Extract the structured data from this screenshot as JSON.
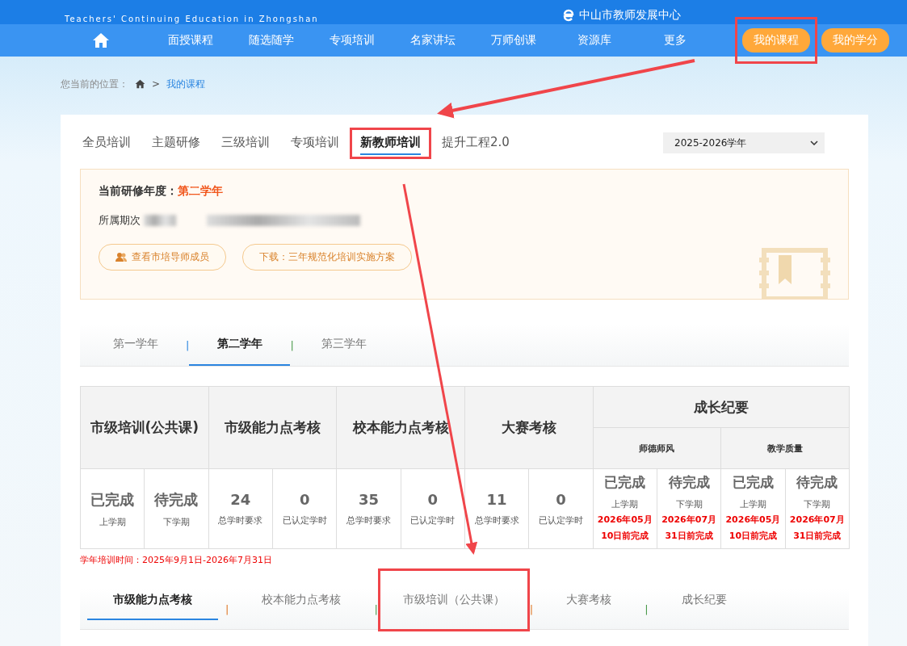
{
  "header": {
    "subtitle": "Teachers' Continuing Education in Zhongshan",
    "org": "中山市教师发展中心"
  },
  "nav": {
    "items": [
      {
        "label": "面授课程",
        "kind": "link",
        "highlighted": false
      },
      {
        "label": "随选随学",
        "kind": "link",
        "highlighted": false
      },
      {
        "label": "专项培训",
        "kind": "link",
        "highlighted": false
      },
      {
        "label": "名家讲坛",
        "kind": "link",
        "highlighted": false
      },
      {
        "label": "万师创课",
        "kind": "link",
        "highlighted": false
      },
      {
        "label": "资源库",
        "kind": "link",
        "highlighted": false
      },
      {
        "label": "更多",
        "kind": "link",
        "highlighted": false
      },
      {
        "label": "我的课程",
        "kind": "pill",
        "highlighted": true
      },
      {
        "label": "我的学分",
        "kind": "pill",
        "highlighted": false
      }
    ]
  },
  "breadcrumb": {
    "label": "您当前的位置：",
    "separator": ">",
    "current": "我的课程"
  },
  "category_tabs": [
    {
      "label": "全员培训",
      "selected": false,
      "highlighted": false
    },
    {
      "label": "主题研修",
      "selected": false,
      "highlighted": false
    },
    {
      "label": "三级培训",
      "selected": false,
      "highlighted": false
    },
    {
      "label": "专项培训",
      "selected": false,
      "highlighted": false
    },
    {
      "label": "新教师培训",
      "selected": true,
      "highlighted": true
    },
    {
      "label": "提升工程2.0",
      "selected": false,
      "highlighted": false
    }
  ],
  "year_select": {
    "value": "2025-2026学年"
  },
  "info": {
    "year_label": "当前研修年度：",
    "year_value": "第二学年",
    "period_label": "所属期次",
    "buttons": [
      {
        "label": "查看市培导师成员",
        "icon": true
      },
      {
        "label": "下载：三年规范化培训实施方案",
        "icon": false
      }
    ]
  },
  "year_tabs": [
    {
      "label": "第一学年",
      "selected": false
    },
    {
      "separator": "|",
      "label": "第二学年",
      "selected": true
    },
    {
      "separator": "|",
      "label": "第三学年",
      "selected": false
    }
  ],
  "table": {
    "groups": [
      {
        "title": "市级培训(公共课)",
        "cells": [
          {
            "value": "已完成",
            "caption": "上学期"
          },
          {
            "value": "待完成",
            "caption": "下学期"
          }
        ]
      },
      {
        "title": "市级能力点考核",
        "cells": [
          {
            "value": "24",
            "caption": "总学时要求"
          },
          {
            "value": "0",
            "caption": "已认定学时"
          }
        ]
      },
      {
        "title": "校本能力点考核",
        "cells": [
          {
            "value": "35",
            "caption": "总学时要求"
          },
          {
            "value": "0",
            "caption": "已认定学时"
          }
        ]
      },
      {
        "title": "大赛考核",
        "cells": [
          {
            "value": "11",
            "caption": "总学时要求"
          },
          {
            "value": "0",
            "caption": "已认定学时"
          }
        ]
      },
      {
        "title": "成长纪要",
        "subgroups": [
          {
            "title": "师德师风",
            "cells": [
              {
                "value": "已完成",
                "caption": "上学期",
                "deadline": [
                  "2026年05月",
                  "10日前完成"
                ]
              },
              {
                "value": "待完成",
                "caption": "下学期",
                "deadline": [
                  "2026年07月",
                  "31日前完成"
                ]
              }
            ]
          },
          {
            "title": "教学质量",
            "cells": [
              {
                "value": "已完成",
                "caption": "上学期",
                "deadline": [
                  "2026年05月",
                  "10日前完成"
                ]
              },
              {
                "value": "待完成",
                "caption": "下学期",
                "deadline": [
                  "2026年07月",
                  "31日前完成"
                ]
              }
            ]
          }
        ]
      }
    ]
  },
  "note": "学年培训时间：2025年9月1日-2026年7月31日",
  "bottom_tabs": [
    {
      "label": "市级能力点考核",
      "selected": true,
      "highlighted": false
    },
    {
      "separator": "|",
      "label": "校本能力点考核",
      "selected": false,
      "highlighted": false
    },
    {
      "separator": "|",
      "label": "市级培训（公共课）",
      "selected": false,
      "highlighted": true
    },
    {
      "separator": "|",
      "label": "大赛考核",
      "selected": false,
      "highlighted": false
    },
    {
      "separator": "|",
      "label": "成长纪要",
      "selected": false,
      "highlighted": false
    }
  ]
}
